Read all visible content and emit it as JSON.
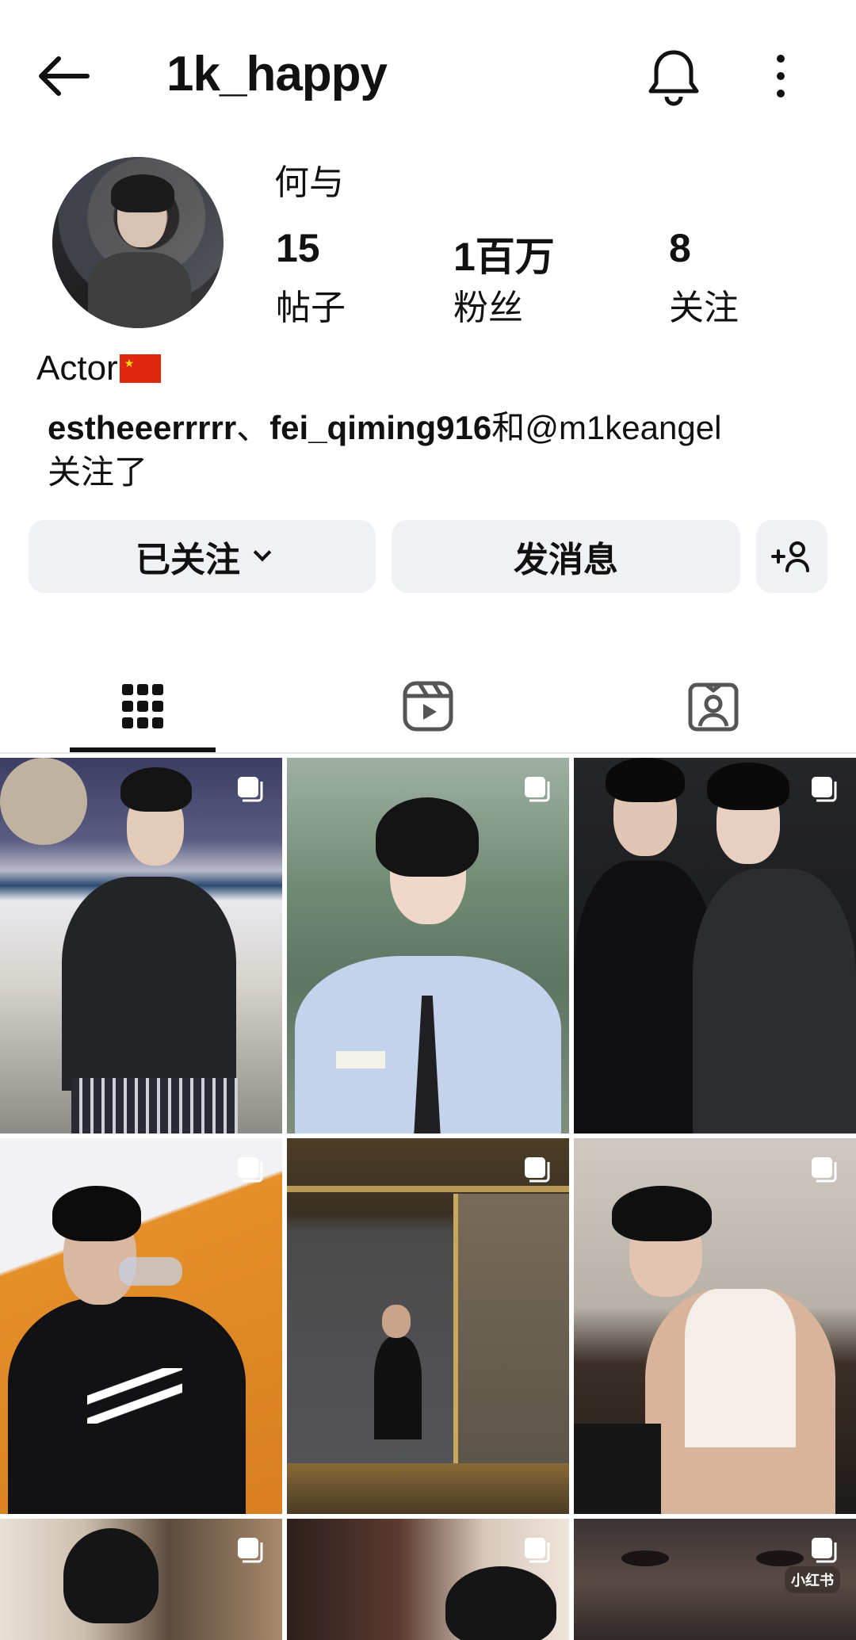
{
  "header": {
    "username": "1k_happy",
    "icons": [
      "back-arrow-icon",
      "bell-icon",
      "more-vertical-icon"
    ]
  },
  "profile": {
    "display_name": "何与",
    "stats": [
      {
        "value": "15",
        "label": "帖子"
      },
      {
        "value": "1百万",
        "label": "粉丝"
      },
      {
        "value": "8",
        "label": "关注"
      }
    ],
    "bio": "Actor",
    "followed_by": {
      "names": [
        "estheeerrrrr",
        "fei_qiming916"
      ],
      "sep": "、",
      "and": "和",
      "rest": "@m1keangel",
      "suffix": "关注了"
    }
  },
  "actions": {
    "follow_label": "已关注",
    "message_label": "发消息",
    "add_user_icon": "add-person-icon"
  },
  "tabs": [
    {
      "name": "posts-grid",
      "icon": "grid-icon",
      "active": true
    },
    {
      "name": "reels",
      "icon": "reels-icon",
      "active": false
    },
    {
      "name": "tagged",
      "icon": "tagged-person-icon",
      "active": false
    }
  ],
  "posts": [
    {
      "badge": "carousel-icon"
    },
    {
      "badge": "carousel-icon"
    },
    {
      "badge": "carousel-icon"
    },
    {
      "badge": "carousel-icon"
    },
    {
      "badge": "carousel-icon"
    },
    {
      "badge": "carousel-icon"
    },
    {
      "badge": "carousel-icon"
    },
    {
      "badge": "carousel-icon"
    },
    {
      "badge": "carousel-icon"
    }
  ],
  "watermark": "小红书",
  "colors": {
    "button_bg": "#eff1f4",
    "flag_red": "#de2910",
    "flag_yellow": "#ffde00"
  }
}
